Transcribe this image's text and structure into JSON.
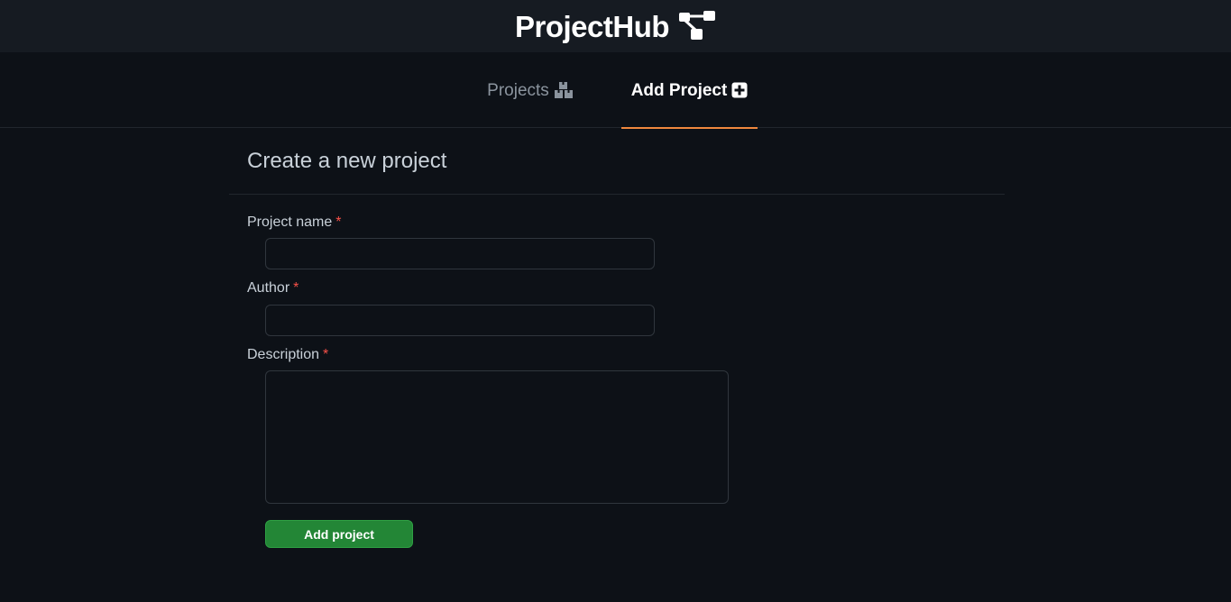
{
  "header": {
    "title": "ProjectHub",
    "icon": "sitemap-icon"
  },
  "tabs": [
    {
      "label": "Projects",
      "icon": "boxes-icon",
      "active": false
    },
    {
      "label": "Add Project",
      "icon": "plus-square-icon",
      "active": true
    }
  ],
  "form": {
    "heading": "Create a new project",
    "required_marker": "*",
    "fields": {
      "project_name": {
        "label": "Project name",
        "value": "",
        "placeholder": ""
      },
      "author": {
        "label": "Author",
        "value": "",
        "placeholder": ""
      },
      "description": {
        "label": "Description",
        "value": "",
        "placeholder": ""
      }
    },
    "submit_label": "Add project"
  },
  "colors": {
    "background": "#0d1117",
    "header_bg": "#161b22",
    "accent_underline": "#f0883e",
    "submit_green": "#238636",
    "required_red": "#f85149"
  }
}
